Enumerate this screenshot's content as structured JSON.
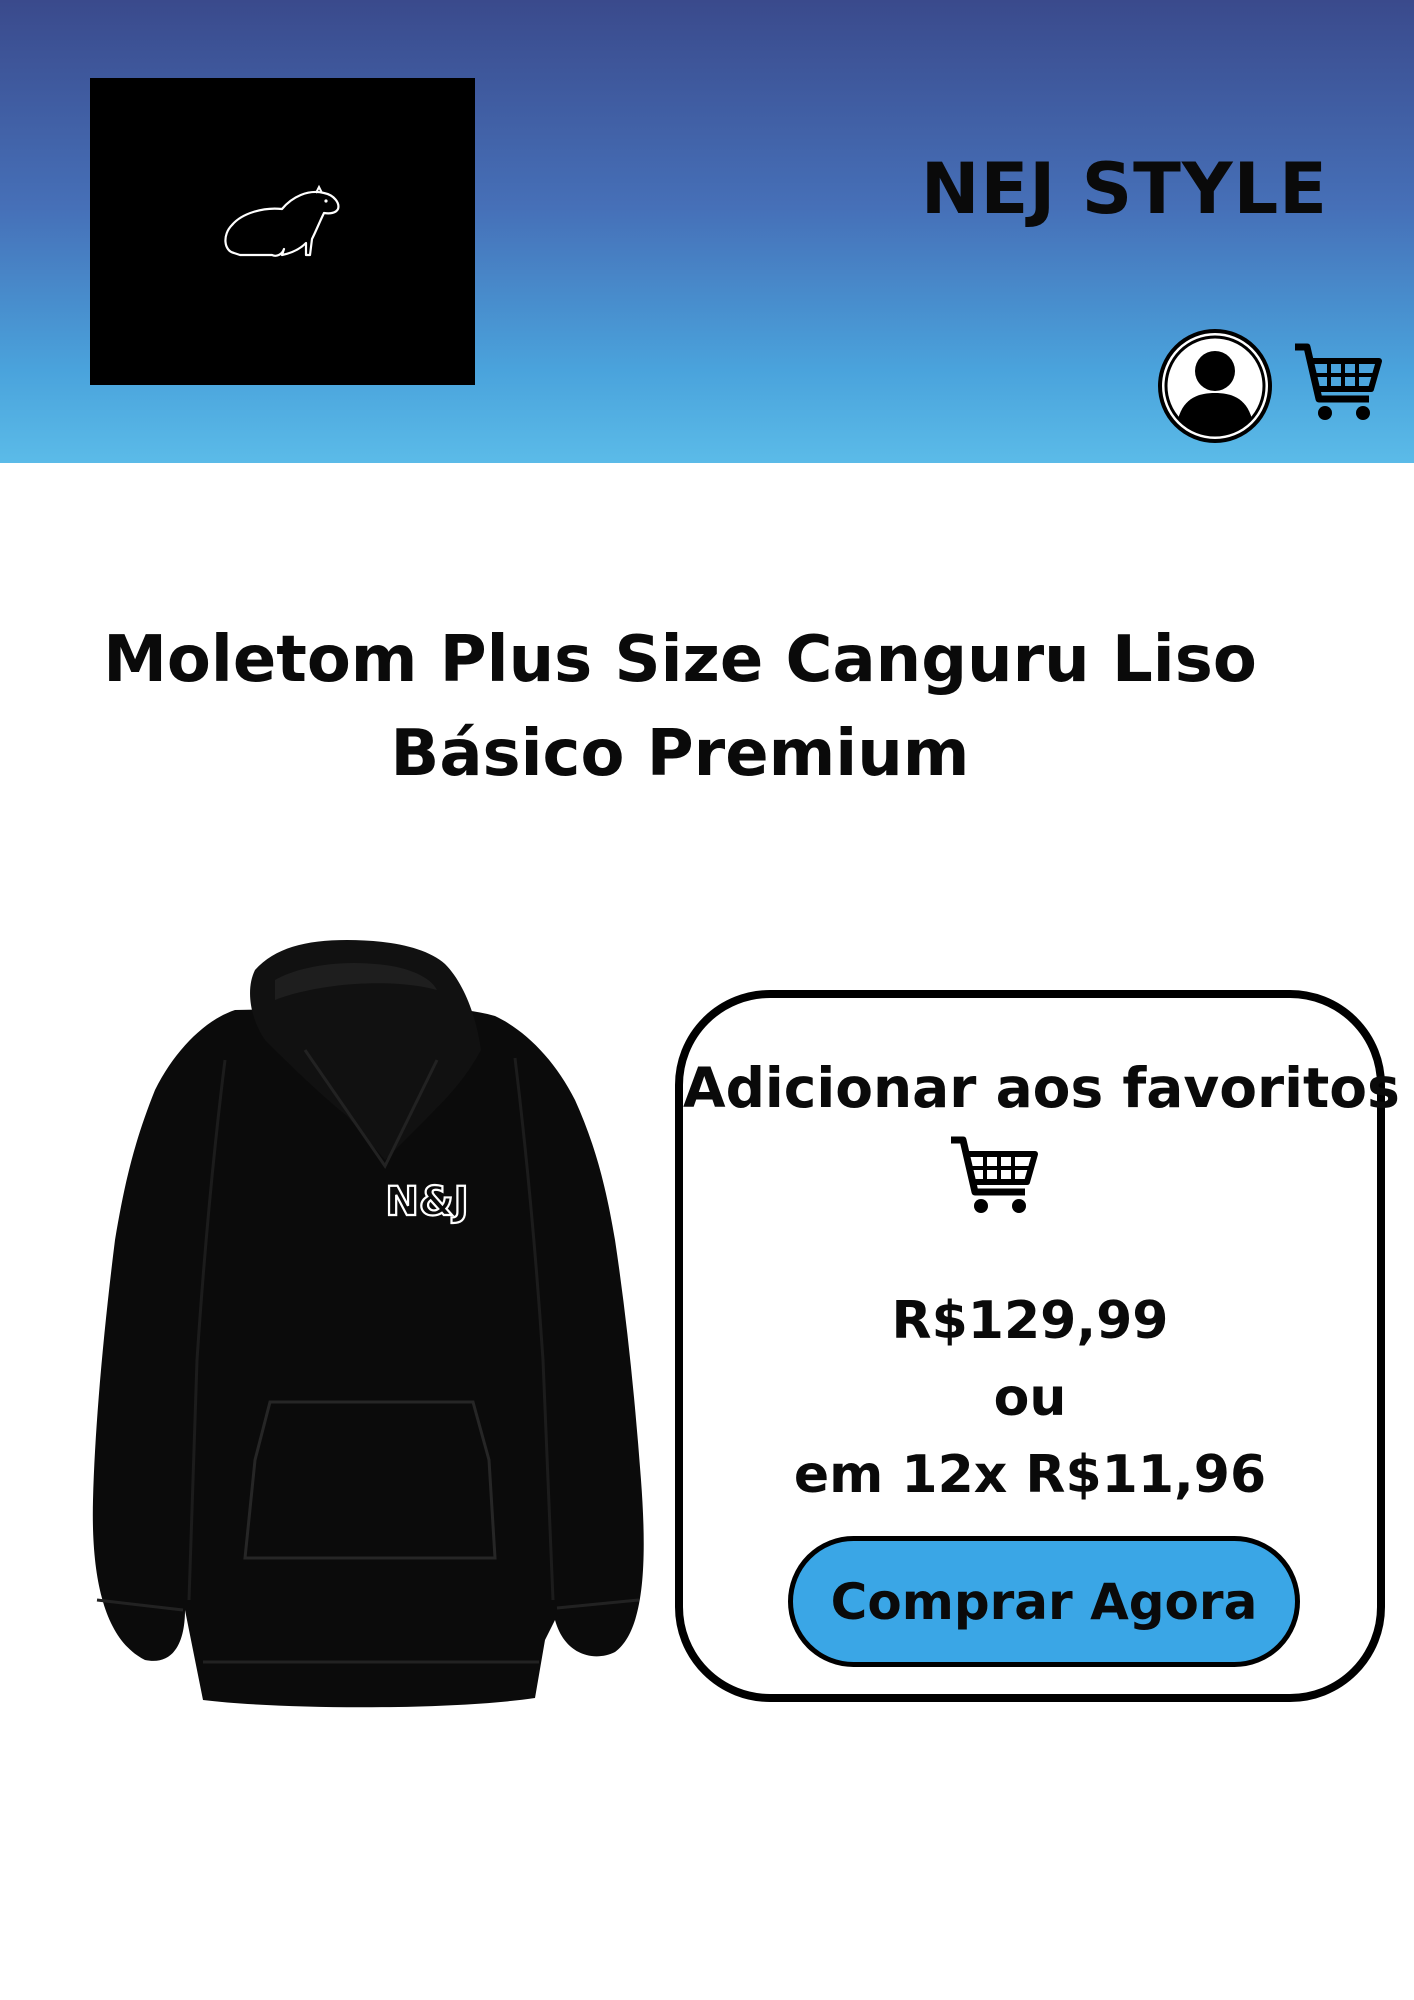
{
  "header": {
    "brand": "NEJ STYLE",
    "logo_icon": "capybara-icon",
    "account_icon": "user-icon",
    "cart_icon": "cart-icon"
  },
  "product": {
    "title_line1": "Moletom Plus Size Canguru Liso",
    "title_line2": "Básico Premium",
    "print_logo_text": "N&J"
  },
  "purchase": {
    "favorites_label": "Adicionar aos favoritos",
    "price": "R$129,99",
    "or_text": "ou",
    "installments": "em 12x R$11,96",
    "buy_button_label": "Comprar Agora"
  },
  "colors": {
    "header_top": "#3a4a8c",
    "header_bottom": "#5bbbe8",
    "button": "#3aa6e6",
    "text": "#0a0a0a"
  }
}
